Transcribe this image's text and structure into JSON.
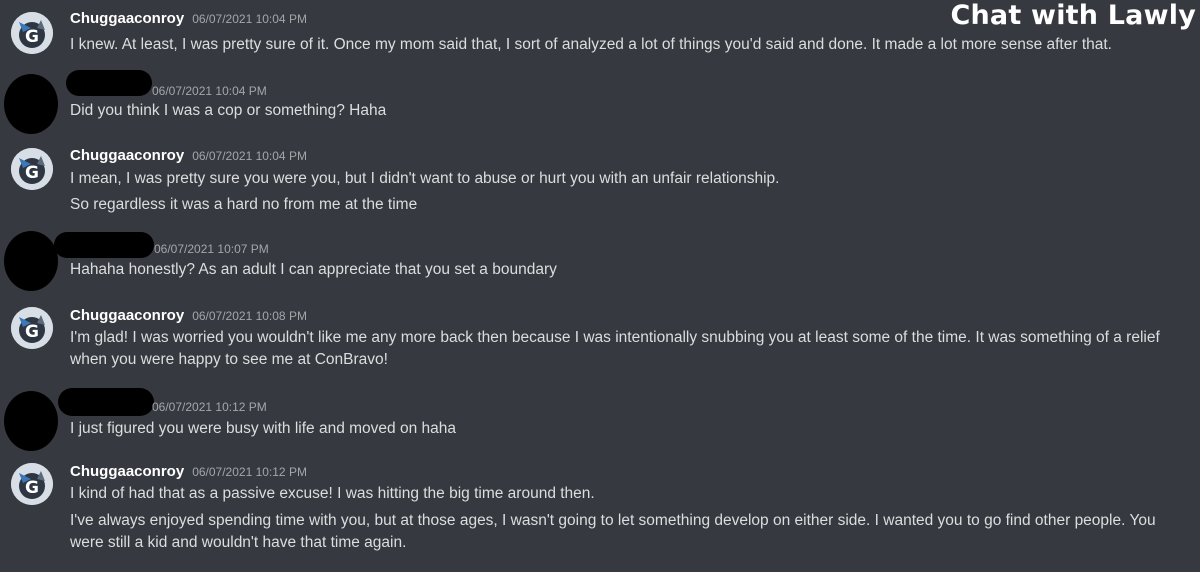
{
  "overlay_title": "Chat with Lawly",
  "messages": [
    {
      "author": "Chuggaaconroy",
      "avatar": "chuggaaconroy-avatar-icon",
      "redacted": false,
      "timestamp": "06/07/2021 10:04 PM",
      "lines": [
        "I knew. At least, I was pretty sure of it. Once my mom said that, I sort of analyzed a lot of things you'd said and done. It made a lot more sense after that."
      ]
    },
    {
      "author": "",
      "avatar": "redacted-avatar",
      "redacted": true,
      "timestamp": "06/07/2021 10:04 PM",
      "lines": [
        "Did you think I was a cop or something? Haha"
      ]
    },
    {
      "author": "Chuggaaconroy",
      "avatar": "chuggaaconroy-avatar-icon",
      "redacted": false,
      "timestamp": "06/07/2021 10:04 PM",
      "lines": [
        "I mean, I was pretty sure you were you, but I didn't want to abuse or hurt you with an unfair relationship.",
        "So regardless it was a hard no from me at the time"
      ]
    },
    {
      "author": "",
      "avatar": "redacted-avatar",
      "redacted": true,
      "timestamp": "06/07/2021 10:07 PM",
      "lines": [
        "Hahaha honestly? As an adult I can appreciate that you set a boundary"
      ]
    },
    {
      "author": "Chuggaaconroy",
      "avatar": "chuggaaconroy-avatar-icon",
      "redacted": false,
      "timestamp": "06/07/2021 10:08 PM",
      "lines": [
        "I'm glad! I was worried you wouldn't like me any more back then because I was intentionally snubbing you at least some of the time. It was something of a relief when you were happy to see me at ConBravo!"
      ]
    },
    {
      "author": "",
      "avatar": "redacted-avatar",
      "redacted": true,
      "timestamp": "06/07/2021 10:12 PM",
      "lines": [
        "I just figured you were busy with life and moved on haha"
      ]
    },
    {
      "author": "Chuggaaconroy",
      "avatar": "chuggaaconroy-avatar-icon",
      "redacted": false,
      "timestamp": "06/07/2021 10:12 PM",
      "lines": [
        "I kind of had that as a passive excuse! I was hitting the big time around then.",
        "I've always enjoyed spending time with you, but at those ages, I wasn't going to let something develop on either side. I wanted you to go find other people. You were still a kid and wouldn't have that time again."
      ]
    }
  ]
}
